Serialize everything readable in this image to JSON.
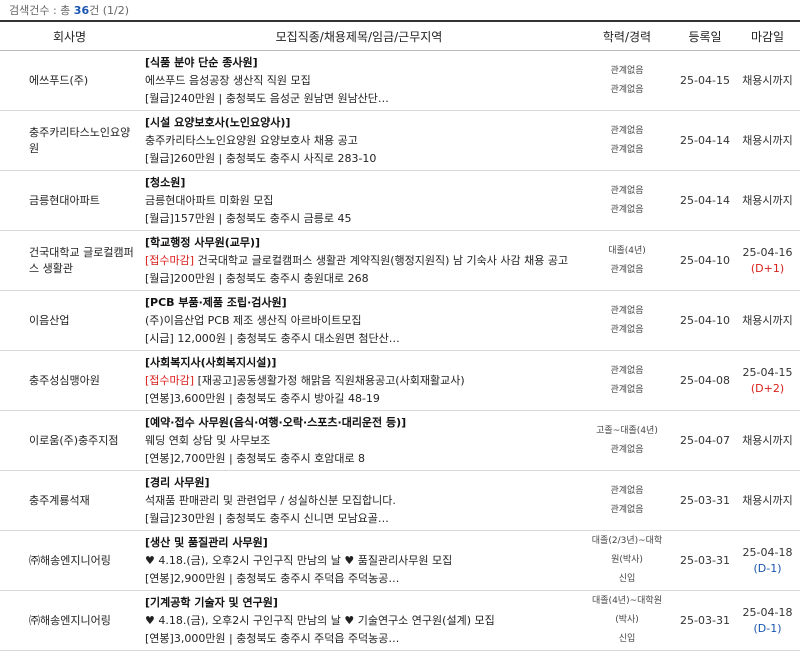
{
  "summary": {
    "prefix": "검색건수 : 총 ",
    "count": "36",
    "suffix": "건 (1/2)"
  },
  "headers": {
    "company": "회사명",
    "job": "모집직종/채용제목/임금/근무지역",
    "edu": "학력/경력",
    "reg": "등록일",
    "deadline": "마감일"
  },
  "rows": [
    {
      "company": "에쓰푸드(주)",
      "title": "[식품 분야 단순 종사원]",
      "tag": "",
      "subject": "에쓰푸드 음성공장 생산직 직원 모집",
      "meta": "[월급]240만원 | 충청북도 음성군 원남면 원남산단…",
      "edu": [
        "관계없음",
        "관계없음"
      ],
      "reg": "25-04-15",
      "deadline": "채용시까지",
      "dday": "",
      "dday_type": ""
    },
    {
      "company": "충주카리타스노인요양원",
      "title": "[시설 요양보호사(노인요양사)]",
      "tag": "",
      "subject": "충주카리타스노인요양원 요양보호사 채용 공고",
      "meta": "[월급]260만원 | 충청북도 충주시 사직로 283-10",
      "edu": [
        "관계없음",
        "관계없음"
      ],
      "reg": "25-04-14",
      "deadline": "채용시까지",
      "dday": "",
      "dday_type": ""
    },
    {
      "company": "금릉현대아파트",
      "title": "[청소원]",
      "tag": "",
      "subject": "금릉현대아파트 미화원 모집",
      "meta": "[월급]157만원 | 충청북도 충주시 금릉로 45",
      "edu": [
        "관계없음",
        "관계없음"
      ],
      "reg": "25-04-14",
      "deadline": "채용시까지",
      "dday": "",
      "dday_type": ""
    },
    {
      "company": "건국대학교 글로컬캠퍼스 생활관",
      "title": "[학교행정 사무원(교무)]",
      "tag": "[접수마감]",
      "subject": " 건국대학교 글로컬캠퍼스 생활관 계약직원(행정지원직) 남 기숙사 사감 채용 공고",
      "meta": "[월급]200만원 | 충청북도 충주시 충원대로 268",
      "edu": [
        "대졸(4년)",
        "관계없음"
      ],
      "reg": "25-04-10",
      "deadline": "25-04-16",
      "dday": "(D+1)",
      "dday_type": "red"
    },
    {
      "company": "이음산업",
      "title": "[PCB 부품·제품 조립·검사원]",
      "tag": "",
      "subject": "(주)이음산업 PCB 제조 생산직 아르바이트모집",
      "meta": "[시급] 12,000원 | 충청북도 충주시 대소원면 첨단산…",
      "edu": [
        "관계없음",
        "관계없음"
      ],
      "reg": "25-04-10",
      "deadline": "채용시까지",
      "dday": "",
      "dday_type": ""
    },
    {
      "company": "충주성심맹아원",
      "title": "[사회복지사(사회복지시설)]",
      "tag": "[접수마감]",
      "subject": " [재공고]공동생활가정 해맑음 직원채용공고(사회재활교사)",
      "meta": "[연봉]3,600만원 | 충청북도 충주시 방아길 48-19",
      "edu": [
        "관계없음",
        "관계없음"
      ],
      "reg": "25-04-08",
      "deadline": "25-04-15",
      "dday": "(D+2)",
      "dday_type": "red"
    },
    {
      "company": "이로움(주)충주지점",
      "title": "[예약·접수 사무원(음식·여행·오락·스포츠·대리운전 등)]",
      "tag": "",
      "subject": "웨딩 연회 상담 및 사무보조",
      "meta": "[연봉]2,700만원 | 충청북도 충주시 호암대로 8",
      "edu": [
        "고졸~대졸(4년)",
        "관계없음"
      ],
      "reg": "25-04-07",
      "deadline": "채용시까지",
      "dday": "",
      "dday_type": ""
    },
    {
      "company": "충주계룡석재",
      "title": "[경리 사무원]",
      "tag": "",
      "subject": "석재품 판매관리 및 관련업무 / 성실하신분 모집합니다.",
      "meta": "[월급]230만원 | 충청북도 충주시 신니면 모남요골…",
      "edu": [
        "관계없음",
        "관계없음"
      ],
      "reg": "25-03-31",
      "deadline": "채용시까지",
      "dday": "",
      "dday_type": ""
    },
    {
      "company": "㈜해송엔지니어링",
      "title": "[생산 및 품질관리 사무원]",
      "tag": "",
      "subject": "♥ 4.18.(금), 오후2시 구인구직 만남의 날 ♥ 품질관리사무원 모집",
      "meta": "[연봉]2,900만원 | 충청북도 충주시 주덕읍 주덕농공…",
      "edu": [
        "대졸(2/3년)~대학",
        "원(박사)",
        "신입"
      ],
      "reg": "25-03-31",
      "deadline": "25-04-18",
      "dday": "(D-1)",
      "dday_type": "blue"
    },
    {
      "company": "㈜해송엔지니어링",
      "title": "[기계공학 기술자 및 연구원]",
      "tag": "",
      "subject": "♥ 4.18.(금), 오후2시 구인구직 만남의 날 ♥ 기술연구소 연구원(설계) 모집",
      "meta": "[연봉]3,000만원 | 충청북도 충주시 주덕읍 주덕농공…",
      "edu": [
        "대졸(4년)~대학원",
        "(박사)",
        "신입"
      ],
      "reg": "25-03-31",
      "deadline": "25-04-18",
      "dday": "(D-1)",
      "dday_type": "blue"
    }
  ]
}
